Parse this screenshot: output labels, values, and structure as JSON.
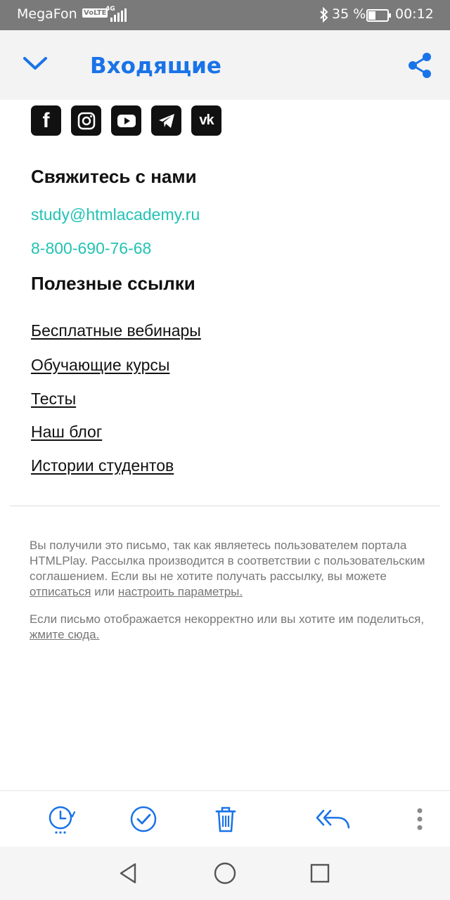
{
  "status_bar": {
    "carrier": "MegaFon",
    "volte": "VoLTE",
    "network": "4G",
    "battery": "35 %",
    "time": "00:12"
  },
  "header": {
    "title": "Входящие",
    "back_icon": "chevron-down-icon",
    "share_icon": "share-icon"
  },
  "social": [
    {
      "name": "facebook",
      "glyph": "f"
    },
    {
      "name": "instagram",
      "glyph": ""
    },
    {
      "name": "youtube",
      "glyph": ""
    },
    {
      "name": "telegram",
      "glyph": ""
    },
    {
      "name": "vk",
      "glyph": "vk"
    }
  ],
  "contact": {
    "heading": "Свяжитесь с нами",
    "email": "study@htmlacademy.ru",
    "phone": "8-800-690-76-68"
  },
  "useful_links": {
    "heading": "Полезные ссылки",
    "items": [
      "Бесплатные вебинары",
      "Обучающие курсы",
      "Тесты",
      "Наш блог",
      "Истории студентов"
    ]
  },
  "footer": {
    "notice_text": "Вы получили это письмо, так как являетесь пользователем портала HTMLPlay. Рассылка производится в соответствии с пользовательским соглашением. Если вы не хотите получать рассылку, вы можете ",
    "unsubscribe": "отписаться",
    "or_text": " или ",
    "settings": "настроить параметры.",
    "display_text": "Если письмо отображается некорректно или вы хотите им поделиться, ",
    "click_here": "жмите сюда."
  },
  "colors": {
    "accent": "#1a73e8",
    "contact": "#22c3b4",
    "status_bar": "#7a7a7a"
  }
}
